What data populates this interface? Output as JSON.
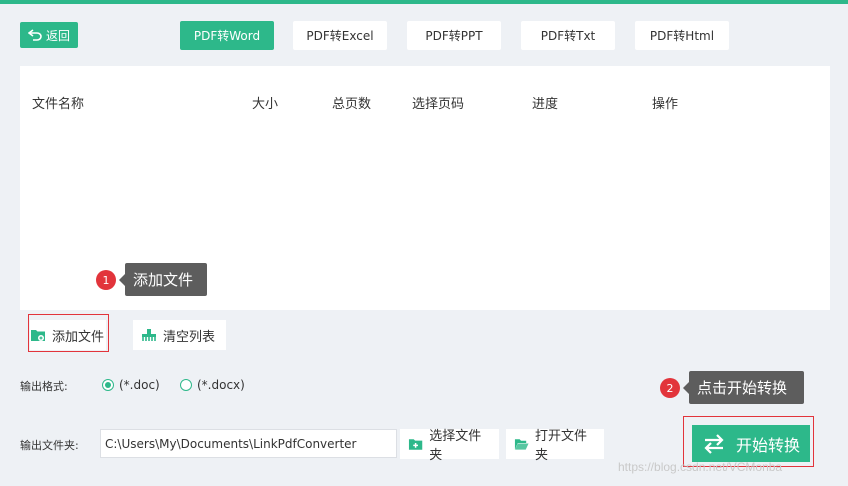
{
  "toolbar": {
    "back_label": "返回",
    "tabs": [
      "PDF转Word",
      "PDF转Excel",
      "PDF转PPT",
      "PDF转Txt",
      "PDF转Html"
    ],
    "active_tab": "PDF转Word"
  },
  "file_table": {
    "columns": [
      "文件名称",
      "大小",
      "总页数",
      "选择页码",
      "进度",
      "操作"
    ],
    "rows": []
  },
  "annotations": [
    {
      "number": "1",
      "text": "添加文件"
    },
    {
      "number": "2",
      "text": "点击开始转换"
    }
  ],
  "actions": {
    "add_file_label": "添加文件",
    "clear_list_label": "清空列表"
  },
  "output_format": {
    "label": "输出格式:",
    "options": [
      "(*.doc)",
      "(*.docx)"
    ],
    "selected": "(*.doc)"
  },
  "output_folder": {
    "label": "输出文件夹:",
    "path": "C:\\Users\\My\\Documents\\LinkPdfConverter",
    "select_label": "选择文件夹",
    "open_label": "打开文件夹"
  },
  "start_label": "开始转换",
  "watermark": "https://blog.csdn.net/VCMonba",
  "colors": {
    "accent": "#2db88a",
    "annotation": "#e2343b",
    "callout_bg": "#5d5d5d"
  }
}
